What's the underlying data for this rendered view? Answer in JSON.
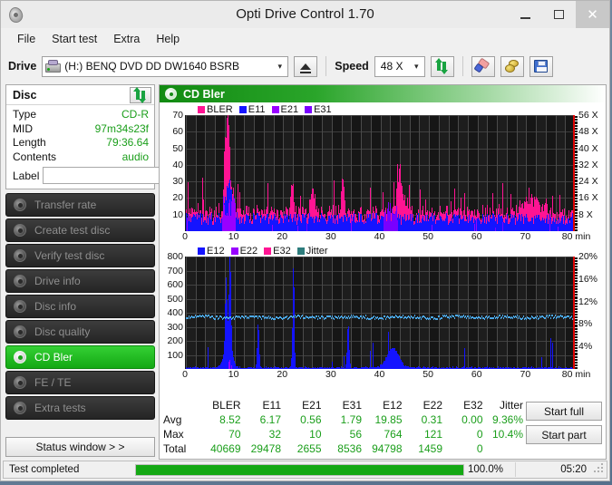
{
  "window": {
    "title": "Opti Drive Control 1.70",
    "app_icon": "disc-icon",
    "minimize": "–",
    "maximize": "□",
    "close": "✕"
  },
  "menu": {
    "items": [
      "File",
      "Start test",
      "Extra",
      "Help"
    ]
  },
  "toolbar": {
    "drive_label": "Drive",
    "drive_value": "(H:)   BENQ DVD DD DW1640 BSRB",
    "eject_title": "eject-button",
    "speed_label": "Speed",
    "speed_value": "48 X",
    "refresh_icon": "refresh-icon",
    "erase_icon": "eraser-icon",
    "gold_icon": "coins-icon",
    "save_icon": "save-icon"
  },
  "disc_panel": {
    "title": "Disc",
    "refresh_icon": "refresh-icon",
    "rows": [
      {
        "key": "Type",
        "value": "CD-R"
      },
      {
        "key": "MID",
        "value": "97m34s23f"
      },
      {
        "key": "Length",
        "value": "79:36.64"
      },
      {
        "key": "Contents",
        "value": "audio"
      }
    ],
    "label_key": "Label",
    "label_value": "",
    "label_placeholder": "",
    "label_button_icon": "disc-icon"
  },
  "nav": {
    "items": [
      {
        "label": "Transfer rate",
        "active": false
      },
      {
        "label": "Create test disc",
        "active": false
      },
      {
        "label": "Verify test disc",
        "active": false
      },
      {
        "label": "Drive info",
        "active": false
      },
      {
        "label": "Disc info",
        "active": false
      },
      {
        "label": "Disc quality",
        "active": false
      },
      {
        "label": "CD Bler",
        "active": true
      },
      {
        "label": "FE / TE",
        "active": false
      },
      {
        "label": "Extra tests",
        "active": false
      }
    ],
    "status_window": "Status window > >"
  },
  "panel": {
    "title": "CD Bler",
    "icon": "disc-icon"
  },
  "stats": {
    "columns": [
      "BLER",
      "E11",
      "E21",
      "E31",
      "E12",
      "E22",
      "E32",
      "Jitter"
    ],
    "rows": [
      {
        "label": "Avg",
        "values": [
          "8.52",
          "6.17",
          "0.56",
          "1.79",
          "19.85",
          "0.31",
          "0.00",
          "9.36%"
        ]
      },
      {
        "label": "Max",
        "values": [
          "70",
          "32",
          "10",
          "56",
          "764",
          "121",
          "0",
          "10.4%"
        ]
      },
      {
        "label": "Total",
        "values": [
          "40669",
          "29478",
          "2655",
          "8536",
          "94798",
          "1459",
          "0",
          ""
        ]
      }
    ],
    "start_full": "Start full",
    "start_part": "Start part"
  },
  "statusbar": {
    "text": "Test completed",
    "percent_label": "100.0%",
    "percent_value": 100,
    "time": "05:20"
  },
  "colors": {
    "bler": "#ff1493",
    "e11": "#1414ff",
    "e21": "#9900ff",
    "e31": "#7a00ff",
    "e12": "#1414ff",
    "e22": "#9900ff",
    "e32": "#ff1493",
    "jitter": "#2e7d7d",
    "jitter_line": "#4aa8e8",
    "accent_green": "#14a814",
    "value_green": "#1a9e1a",
    "plot_bg": "#131313",
    "end_marker": "#e00000"
  },
  "chart_data": [
    {
      "type": "area",
      "id": "cd-bler-chart",
      "title": "CD Bler",
      "xlabel": "min",
      "ylabel": "",
      "xlim": [
        0,
        80
      ],
      "ylim": [
        0,
        70
      ],
      "xticks": [
        0,
        10,
        20,
        30,
        40,
        50,
        60,
        70,
        80
      ],
      "yticks": [
        10,
        20,
        30,
        40,
        50,
        60,
        70
      ],
      "y2label": "X",
      "y2lim": [
        0,
        56
      ],
      "y2ticks": [
        8,
        16,
        24,
        32,
        40,
        48,
        56
      ],
      "y2ticklabels": [
        "8 X",
        "16 X",
        "24 X",
        "32 X",
        "40 X",
        "48 X",
        "56 X"
      ],
      "grid": true,
      "legend_position": "top-left",
      "legend": [
        "BLER",
        "E11",
        "E21",
        "E31"
      ],
      "series": [
        {
          "name": "BLER",
          "color": "#ff1493",
          "avg": 8.52,
          "max": 70,
          "total": 40669
        },
        {
          "name": "E11",
          "color": "#1414ff",
          "avg": 6.17,
          "max": 32,
          "total": 29478
        },
        {
          "name": "E21",
          "color": "#9900ff",
          "avg": 0.56,
          "max": 10,
          "total": 2655
        },
        {
          "name": "E31",
          "color": "#7a00ff",
          "avg": 1.79,
          "max": 56,
          "total": 8536
        }
      ],
      "peak_annotations": [
        {
          "x": 8.6,
          "y": 70,
          "series": "BLER"
        },
        {
          "x": 8.0,
          "y": 57,
          "series": "BLER"
        },
        {
          "x": 32.2,
          "y": 43,
          "series": "BLER"
        },
        {
          "x": 21.8,
          "y": 37,
          "series": "BLER"
        },
        {
          "x": 44.0,
          "y": 30,
          "series": "BLER"
        }
      ]
    },
    {
      "type": "area",
      "id": "e12-jitter-chart",
      "title": "",
      "xlabel": "min",
      "ylabel": "",
      "xlim": [
        0,
        80
      ],
      "ylim": [
        0,
        800
      ],
      "xticks": [
        0,
        10,
        20,
        30,
        40,
        50,
        60,
        70,
        80
      ],
      "yticks": [
        100,
        200,
        300,
        400,
        500,
        600,
        700,
        800
      ],
      "y2label": "%",
      "y2lim": [
        0,
        20
      ],
      "y2ticks": [
        4,
        8,
        12,
        16,
        20
      ],
      "y2ticklabels": [
        "4%",
        "8%",
        "12%",
        "16%",
        "20%"
      ],
      "grid": true,
      "legend_position": "top-left",
      "legend": [
        "E12",
        "E22",
        "E32",
        "Jitter"
      ],
      "series": [
        {
          "name": "E12",
          "color": "#1414ff",
          "avg": 19.85,
          "max": 764,
          "total": 94798
        },
        {
          "name": "E22",
          "color": "#9900ff",
          "avg": 0.31,
          "max": 121,
          "total": 1459
        },
        {
          "name": "E32",
          "color": "#ff1493",
          "avg": 0.0,
          "max": 0,
          "total": 0
        },
        {
          "name": "Jitter",
          "color": "#4aa8e8",
          "avg": "9.36%",
          "max": "10.4%",
          "baseline_pct": 9.36
        }
      ],
      "peak_annotations": [
        {
          "x": 9.0,
          "y": 764,
          "series": "E12"
        },
        {
          "x": 8.2,
          "y": 530,
          "series": "E12"
        },
        {
          "x": 22.0,
          "y": 420,
          "series": "E12"
        },
        {
          "x": 14.8,
          "y": 350,
          "series": "E12"
        },
        {
          "x": 33.3,
          "y": 360,
          "series": "E12"
        }
      ]
    }
  ]
}
